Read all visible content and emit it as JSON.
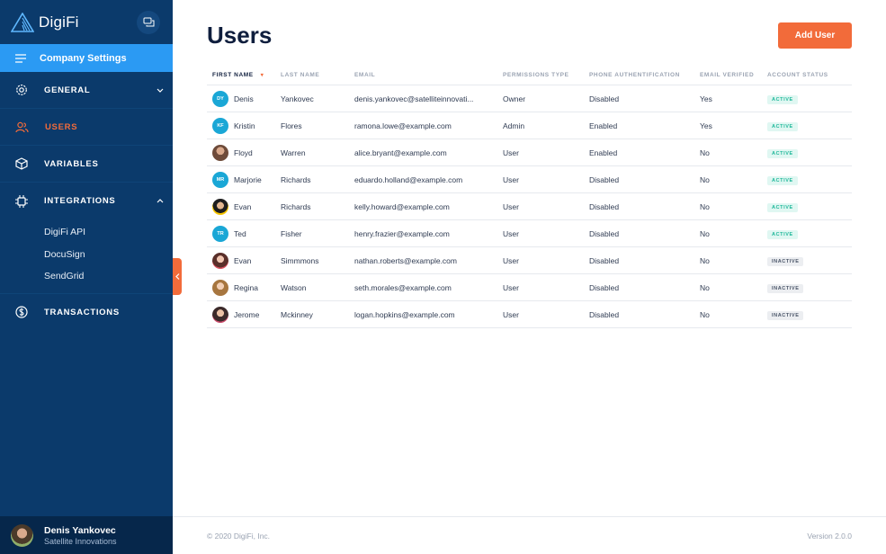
{
  "sidebar": {
    "brand": "DigiFi",
    "company_settings": "Company Settings",
    "items": [
      {
        "label": "GENERAL"
      },
      {
        "label": "USERS"
      },
      {
        "label": "VARIABLES"
      },
      {
        "label": "INTEGRATIONS"
      },
      {
        "label": "TRANSACTIONS"
      }
    ],
    "integrations_sub": [
      "DigiFi API",
      "DocuSign",
      "SendGrid"
    ],
    "user": {
      "name": "Denis Yankovec",
      "company": "Satellite Innovations"
    }
  },
  "main": {
    "title": "Users",
    "add_button": "Add User",
    "columns": [
      "FIRST NAME",
      "LAST NAME",
      "EMAIL",
      "PERMISSIONS TYPE",
      "PHONE AUTHENTIFICATION",
      "EMAIL VERIFIED",
      "ACCOUNT STATUS"
    ],
    "sort_indicator": "▾",
    "rows": [
      {
        "initials": "DY",
        "first": "Denis",
        "last": "Yankovec",
        "email": "denis.yankovec@satelliteinnovati...",
        "perm": "Owner",
        "phone": "Disabled",
        "verified": "Yes",
        "status": "ACTIVE"
      },
      {
        "initials": "KF",
        "first": "Kristin",
        "last": "Flores",
        "email": "ramona.lowe@example.com",
        "perm": "Admin",
        "phone": "Enabled",
        "verified": "Yes",
        "status": "ACTIVE"
      },
      {
        "initials": "",
        "first": "Floyd",
        "last": "Warren",
        "email": "alice.bryant@example.com",
        "perm": "User",
        "phone": "Enabled",
        "verified": "No",
        "status": "ACTIVE"
      },
      {
        "initials": "MR",
        "first": "Marjorie",
        "last": "Richards",
        "email": "eduardo.holland@example.com",
        "perm": "User",
        "phone": "Disabled",
        "verified": "No",
        "status": "ACTIVE"
      },
      {
        "initials": "",
        "first": "Evan",
        "last": "Richards",
        "email": "kelly.howard@example.com",
        "perm": "User",
        "phone": "Disabled",
        "verified": "No",
        "status": "ACTIVE"
      },
      {
        "initials": "TR",
        "first": "Ted",
        "last": "Fisher",
        "email": "henry.frazier@example.com",
        "perm": "User",
        "phone": "Disabled",
        "verified": "No",
        "status": "ACTIVE"
      },
      {
        "initials": "",
        "first": "Evan",
        "last": "Simmmons",
        "email": "nathan.roberts@example.com",
        "perm": "User",
        "phone": "Disabled",
        "verified": "No",
        "status": "INACTIVE"
      },
      {
        "initials": "",
        "first": "Regina",
        "last": "Watson",
        "email": "seth.morales@example.com",
        "perm": "User",
        "phone": "Disabled",
        "verified": "No",
        "status": "INACTIVE"
      },
      {
        "initials": "",
        "first": "Jerome",
        "last": "Mckinney",
        "email": "logan.hopkins@example.com",
        "perm": "User",
        "phone": "Disabled",
        "verified": "No",
        "status": "INACTIVE"
      }
    ]
  },
  "footer": {
    "copyright": "© 2020 DigiFi, Inc.",
    "version": "Version 2.0.0"
  },
  "colors": {
    "sidebar": "#0b3a6b",
    "accent": "#f26b3a",
    "highlight": "#2b9af3",
    "active_badge": "#1fb89a"
  }
}
